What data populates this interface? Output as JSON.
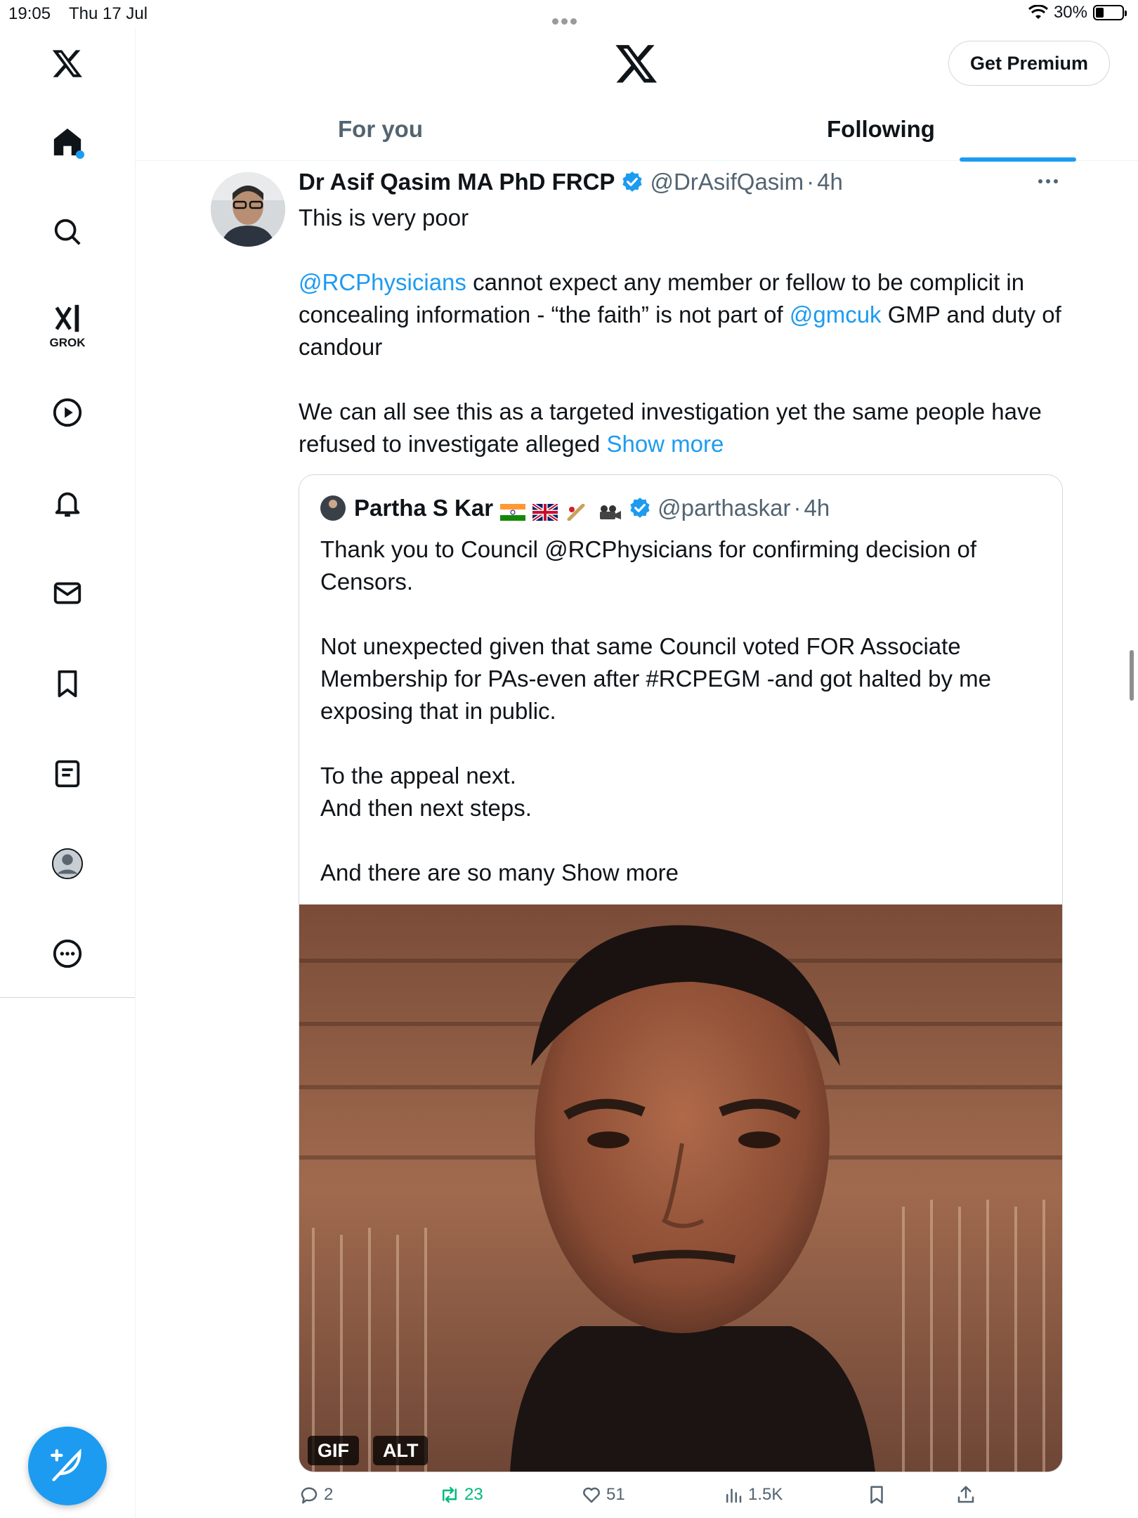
{
  "status_bar": {
    "time": "19:05",
    "date": "Thu 17 Jul",
    "battery_text": "30%",
    "battery_level": 0.3
  },
  "sidebar": {
    "items": [
      {
        "name": "x-logo-icon"
      },
      {
        "name": "home-icon"
      },
      {
        "name": "search-icon"
      },
      {
        "name": "grok-icon",
        "label": "GROK"
      },
      {
        "name": "video-icon"
      },
      {
        "name": "notifications-icon"
      },
      {
        "name": "messages-icon"
      },
      {
        "name": "bookmarks-icon"
      },
      {
        "name": "lists-icon"
      },
      {
        "name": "profile-icon"
      },
      {
        "name": "more-icon"
      }
    ]
  },
  "header": {
    "premium_label": "Get Premium",
    "tabs": [
      {
        "label": "For you",
        "active": false
      },
      {
        "label": "Following",
        "active": true
      }
    ]
  },
  "tweet": {
    "author_name": "Dr Asif Qasim MA PhD FRCP",
    "handle": "@DrAsifQasim",
    "separator": "·",
    "time": "4h",
    "line1": "This is very poor",
    "p2_mention1": "@RCPhysicians",
    "p2_text1": " cannot expect any member or fellow to be complicit in concealing information - “the faith” is not part of ",
    "p2_mention2": "@gmcuk",
    "p2_text2": " GMP and duty of candour",
    "p3_text": "We can all see this as a targeted investigation yet the same people have refused to investigate alleged ",
    "show_more": "Show more",
    "quote": {
      "author_name": "Partha S Kar",
      "handle": "@parthaskar",
      "separator": "·",
      "time": "4h",
      "p1": "Thank you to Council @RCPhysicians for confirming decision of Censors.",
      "p2": "Not unexpected given that same Council voted FOR Associate Membership for PAs-even after #RCPEGM -and got halted by me exposing that in public.",
      "p3_line1": "To the appeal next.",
      "p3_line2": "And then next steps.",
      "p4": "And there are so many Show more",
      "media_badges": [
        "GIF",
        "ALT"
      ]
    },
    "actions": {
      "replies": "2",
      "reposts": "23",
      "likes": "51",
      "views": "1.5K"
    }
  },
  "colors": {
    "accent": "#1d9bf0",
    "repost_active": "#00ba7c",
    "muted_text": "#536471"
  }
}
